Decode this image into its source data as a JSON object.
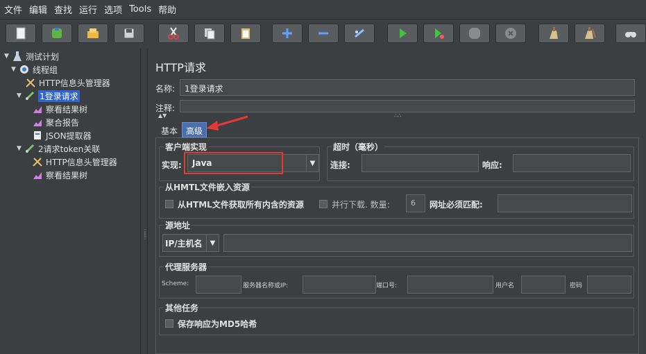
{
  "menu": [
    "文件",
    "编辑",
    "查找",
    "运行",
    "选项",
    "Tools",
    "帮助"
  ],
  "toolbar": {
    "buttons": [
      {
        "name": "new-icon",
        "color": "#f2f2f2"
      },
      {
        "name": "templates-icon",
        "color": "#5fb53f"
      },
      {
        "name": "open-icon",
        "color": "#f0b73e"
      },
      {
        "name": "save-icon",
        "color": "#cfd3d6"
      },
      {
        "name": "cut-icon",
        "color": "#d64545"
      },
      {
        "name": "copy-icon",
        "color": "#d0d0d0"
      },
      {
        "name": "paste-icon",
        "color": "#e0c070"
      },
      {
        "name": "expand-icon",
        "color": "#5fa0ff"
      },
      {
        "name": "collapse-icon",
        "color": "#5fa0ff"
      },
      {
        "name": "toggle-icon",
        "color": "#8fc0ff"
      },
      {
        "name": "start-icon",
        "color": "#3ec43e"
      },
      {
        "name": "start-no-pause-icon",
        "color": "#3ec43e"
      },
      {
        "name": "stop-icon",
        "color": "#8a8a8a"
      },
      {
        "name": "shutdown-icon",
        "color": "#8a8a8a"
      },
      {
        "name": "clear-icon",
        "color": "#d8c090"
      },
      {
        "name": "clear-all-icon",
        "color": "#d8c090"
      },
      {
        "name": "search-binoculars-icon",
        "color": "#ffffff"
      }
    ]
  },
  "tree": {
    "items": [
      {
        "label": "测试计划",
        "icon": "test-plan-icon"
      },
      {
        "label": "线程组",
        "icon": "thread-group-icon"
      },
      {
        "label": "HTTP信息头管理器",
        "icon": "tools-icon"
      },
      {
        "label": "1登录请求",
        "icon": "sampler-icon",
        "selected": true
      },
      {
        "label": "察看结果树",
        "icon": "listener-icon"
      },
      {
        "label": "聚合报告",
        "icon": "listener-icon"
      },
      {
        "label": "JSON提取器",
        "icon": "extractor-icon"
      },
      {
        "label": "2请求token关联",
        "icon": "sampler-icon"
      },
      {
        "label": "HTTP信息头管理器",
        "icon": "tools-icon"
      },
      {
        "label": "察看结果树",
        "icon": "listener-icon"
      }
    ]
  },
  "main": {
    "title": "HTTP请求",
    "name_label": "名称:",
    "name_value": "1登录请求",
    "comment_label": "注释:",
    "tabs": [
      "基本",
      "高级"
    ],
    "client": {
      "title": "客户端实现",
      "impl_label": "实现:",
      "impl_value": "Java"
    },
    "timeout": {
      "title": "超时（毫秒）",
      "connect_label": "连接:",
      "response_label": "响应:"
    },
    "embedded": {
      "title": "从HMTL文件嵌入资源",
      "retrieve_label": "从HTML文件获取所有内含的资源",
      "parallel_label": "并行下载. 数量:",
      "parallel_value": "6",
      "url_match_label": "网址必须匹配:"
    },
    "source": {
      "title": "源地址",
      "type_value": "IP/主机名"
    },
    "proxy": {
      "title": "代理服务器",
      "scheme_label": "Scheme:",
      "server_label": "服务器名称或IP:",
      "port_label": "端口号:",
      "user_label": "用户名",
      "password_label": "密码"
    },
    "other": {
      "title": "其他任务",
      "md5_label": "保存响应为MD5哈希"
    }
  },
  "colors": {
    "selection": "#2f65ca",
    "annotation": "#e53935",
    "active_tab": "#4b6eaf"
  }
}
